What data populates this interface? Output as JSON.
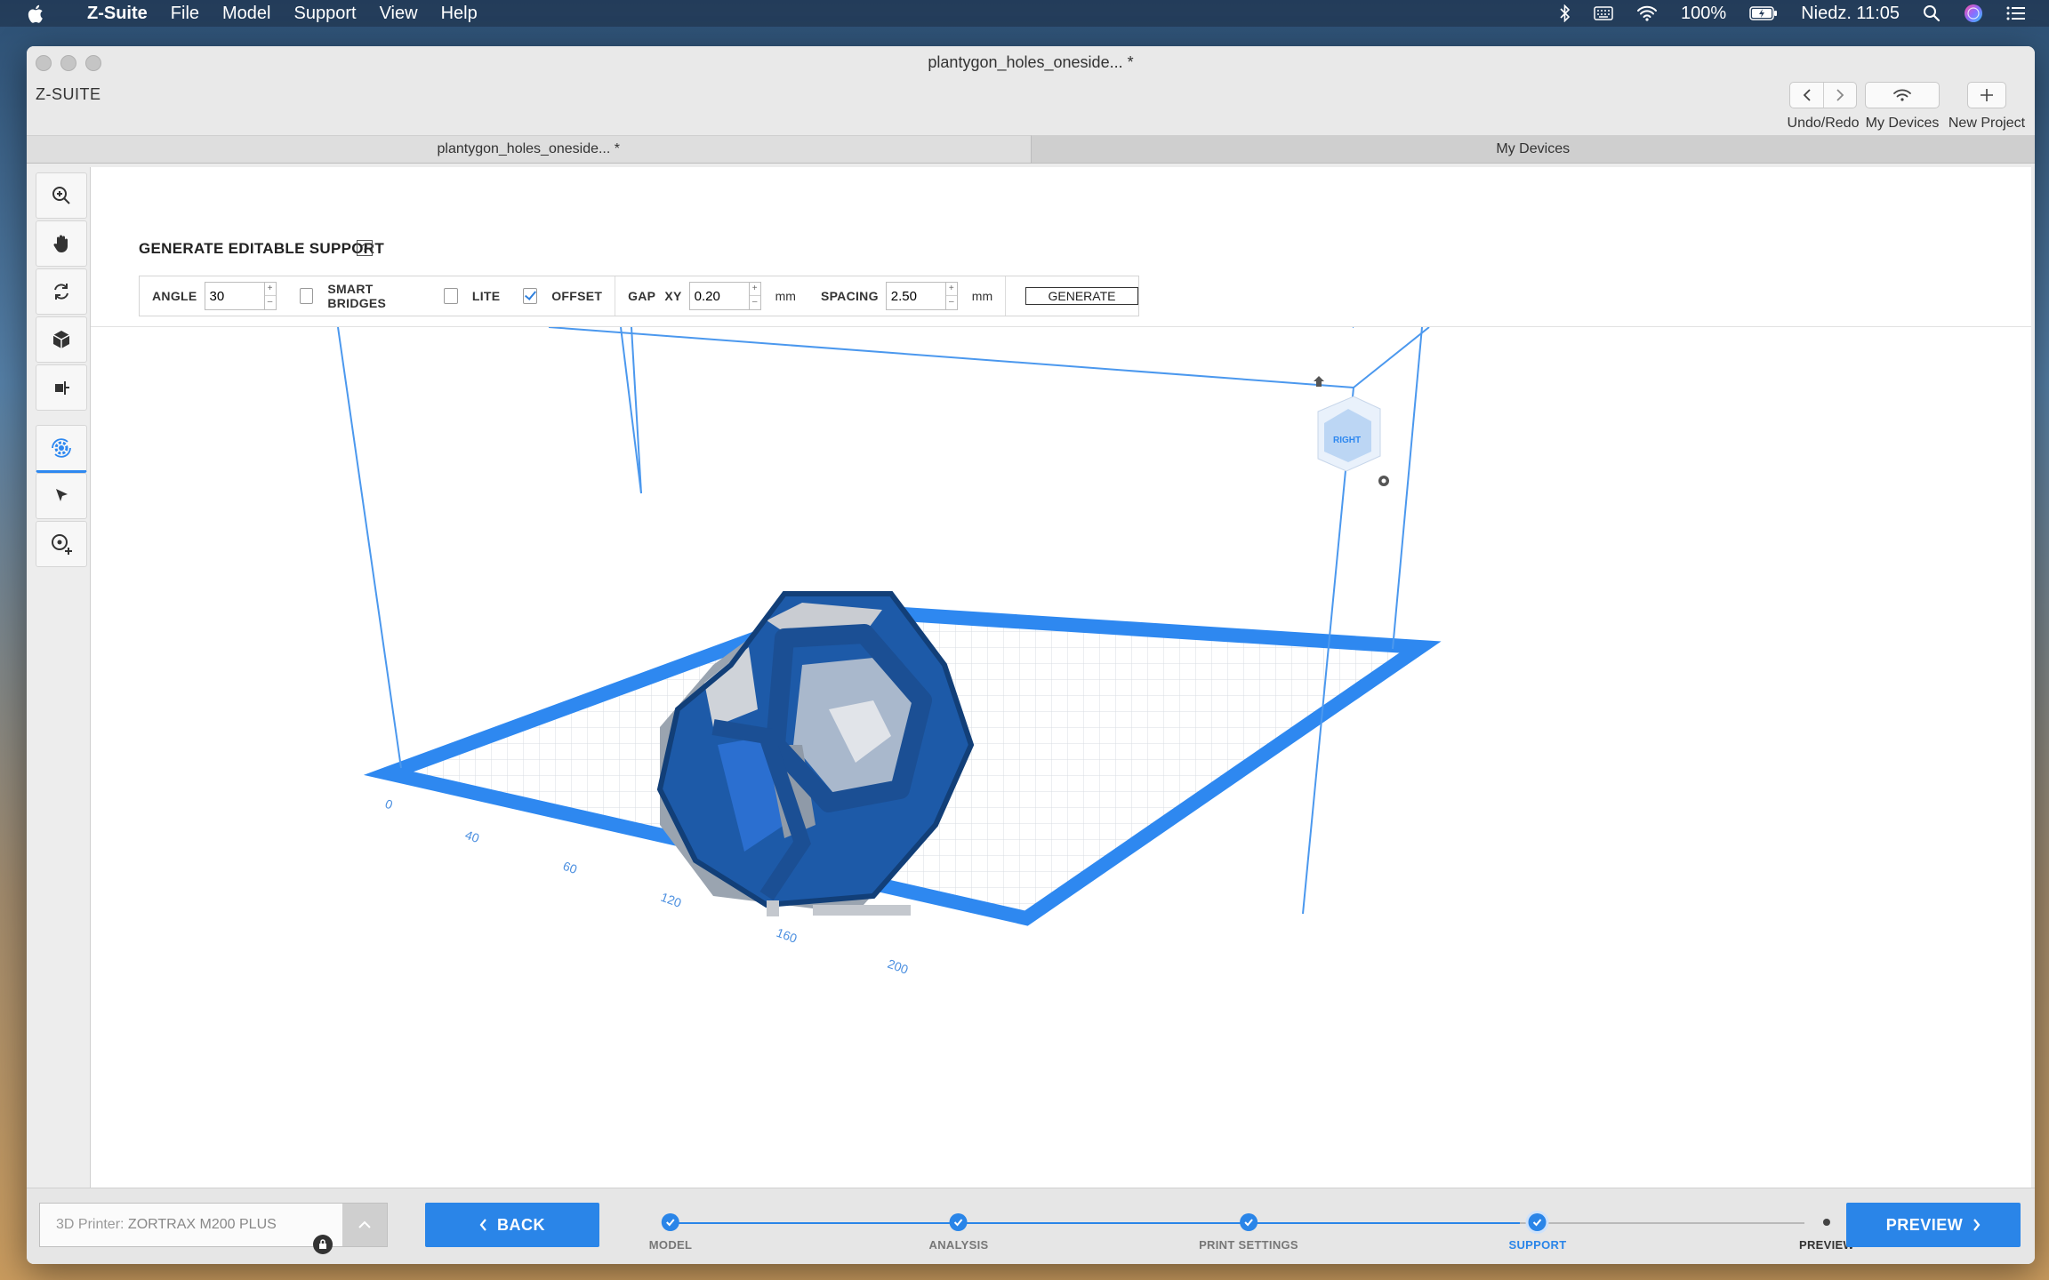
{
  "menubar": {
    "app": "Z-Suite",
    "items": [
      "File",
      "Model",
      "Support",
      "View",
      "Help"
    ],
    "battery": "100%",
    "clock": "Niedz. 11:05"
  },
  "window": {
    "title": "plantygon_holes_oneside... *",
    "brand": "Z-SUITE",
    "toolbar": {
      "undo_redo_label": "Undo/Redo",
      "devices_label": "My Devices",
      "new_project_label": "New Project"
    },
    "tabs": [
      "plantygon_holes_oneside... *",
      "My Devices"
    ]
  },
  "support_panel": {
    "title": "GENERATE EDITABLE SUPPORT",
    "help": "?",
    "angle_label": "ANGLE",
    "angle_value": "30",
    "smart_bridges_label": "SMART BRIDGES",
    "smart_bridges_checked": false,
    "lite_label": "LITE",
    "lite_checked": false,
    "offset_label": "OFFSET",
    "offset_checked": true,
    "gap_label": "GAP",
    "gap_axis": "XY",
    "gap_value": "0.20",
    "gap_unit": "mm",
    "spacing_label": "SPACING",
    "spacing_value": "2.50",
    "spacing_unit": "mm",
    "generate_label": "GENERATE"
  },
  "viewport": {
    "axis_ticks": [
      "0",
      "40",
      "60",
      "120",
      "160",
      "200"
    ],
    "view_cube_face": "RIGHT",
    "accent": "#2e88f0",
    "model_color": "#1f5fb0"
  },
  "bottom": {
    "printer_prefix": "3D Printer: ",
    "printer_name": "ZORTRAX M200 PLUS",
    "back_label": "BACK",
    "preview_label": "PREVIEW",
    "steps": [
      "MODEL",
      "ANALYSIS",
      "PRINT SETTINGS",
      "SUPPORT",
      "PREVIEW"
    ],
    "current_step": "SUPPORT"
  }
}
